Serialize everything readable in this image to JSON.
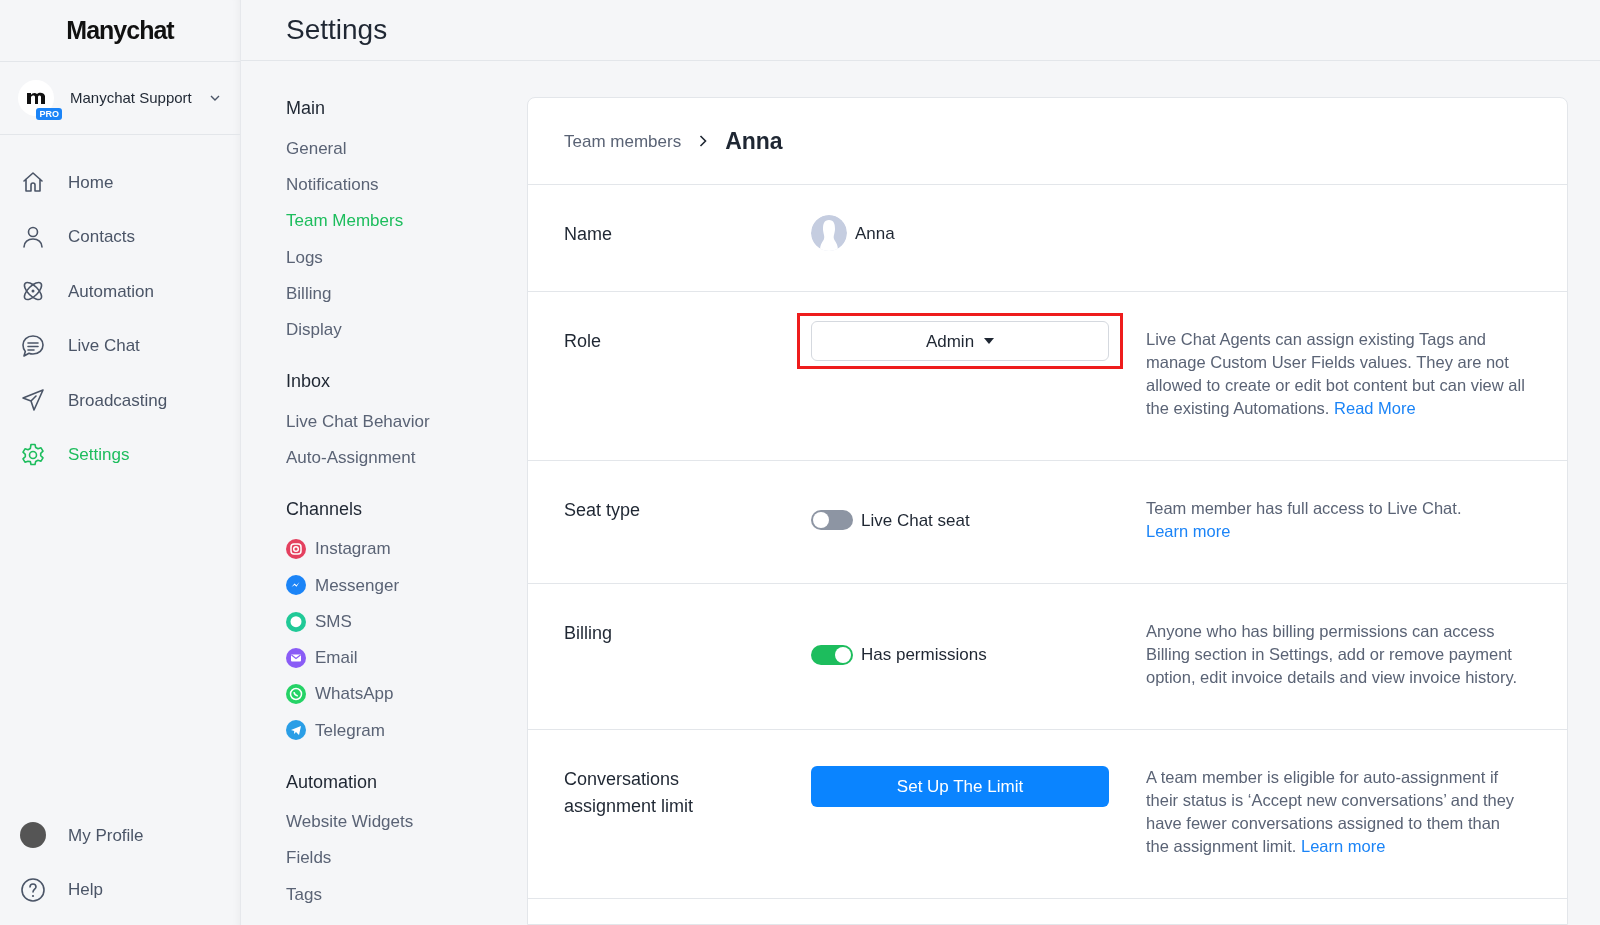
{
  "logo": "Manychat",
  "account": {
    "name": "Manychat Support",
    "badge": "PRO"
  },
  "nav": [
    {
      "label": "Home",
      "kind": "home",
      "selected": false
    },
    {
      "label": "Contacts",
      "kind": "person",
      "selected": false
    },
    {
      "label": "Automation",
      "kind": "atom",
      "selected": false
    },
    {
      "label": "Live Chat",
      "kind": "chat",
      "selected": false
    },
    {
      "label": "Broadcasting",
      "kind": "send",
      "selected": false
    },
    {
      "label": "Settings",
      "kind": "gear",
      "selected": true
    }
  ],
  "nav_bottom": [
    {
      "label": "My Profile",
      "kind": "avatar"
    },
    {
      "label": "Help",
      "kind": "help"
    }
  ],
  "page_title": "Settings",
  "settings_menu": [
    {
      "heading": "Main",
      "items": [
        {
          "label": "General",
          "selected": false
        },
        {
          "label": "Notifications",
          "selected": false
        },
        {
          "label": "Team Members",
          "selected": true
        },
        {
          "label": "Logs",
          "selected": false
        },
        {
          "label": "Billing",
          "selected": false
        },
        {
          "label": "Display",
          "selected": false
        }
      ]
    },
    {
      "heading": "Inbox",
      "items": [
        {
          "label": "Live Chat Behavior",
          "selected": false
        },
        {
          "label": "Auto-Assignment",
          "selected": false
        }
      ]
    },
    {
      "heading": "Channels",
      "items": [
        {
          "label": "Instagram",
          "selected": false,
          "kind": "camera",
          "color": "#e4405f"
        },
        {
          "label": "Messenger",
          "selected": false,
          "kind": "bolt",
          "color": "#1b84f7"
        },
        {
          "label": "SMS",
          "selected": false,
          "kind": "bubble",
          "color": "#20c997"
        },
        {
          "label": "Email",
          "selected": false,
          "kind": "envelope",
          "color": "#8a5cf6"
        },
        {
          "label": "WhatsApp",
          "selected": false,
          "kind": "phone",
          "color": "#25d366"
        },
        {
          "label": "Telegram",
          "selected": false,
          "kind": "plane",
          "color": "#2a9ee6"
        }
      ]
    },
    {
      "heading": "Automation",
      "items": [
        {
          "label": "Website Widgets",
          "selected": false
        },
        {
          "label": "Fields",
          "selected": false
        },
        {
          "label": "Tags",
          "selected": false
        }
      ]
    }
  ],
  "breadcrumb": {
    "parent": "Team members",
    "current": "Anna"
  },
  "rows": [
    {
      "kind": "name",
      "label": "Name",
      "value": "Anna"
    },
    {
      "kind": "dropdown",
      "label": "Role",
      "value": "Admin",
      "highlighted": true,
      "description": "Live Chat Agents can assign existing Tags and manage Custom User Fields values. They are not allowed to create or edit bot content but can view all the existing Automations.",
      "link": "Read More"
    },
    {
      "kind": "toggle",
      "label": "Seat type",
      "on": false,
      "value": "Live Chat seat",
      "description": "Team member has full access to Live Chat.",
      "link": "Learn more"
    },
    {
      "kind": "toggle",
      "label": "Billing",
      "on": true,
      "value": "Has permissions",
      "description": "Anyone who has billing permissions can access Billing section in Settings, add or remove payment option, edit invoice details and view invoice history."
    },
    {
      "kind": "button",
      "label": "Conversations assignment limit",
      "value": "Set Up The Limit",
      "description": "A team member is eligible for auto-assignment if their status is ‘Accept new conversations’ and they have fewer conversations assigned to them than the assignment limit.",
      "link": "Learn more"
    }
  ]
}
